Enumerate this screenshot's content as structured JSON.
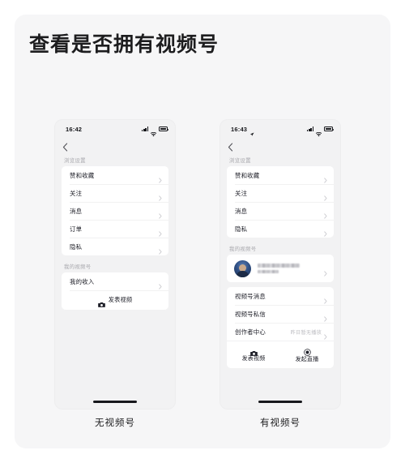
{
  "page": {
    "title": "查看是否拥有视频号",
    "background_color": "#ffffff",
    "card_color": "#f6f6f7"
  },
  "phones": [
    {
      "id": "no-channel",
      "caption": "无视频号",
      "status_bar": {
        "time": "16:42",
        "location_arrow": false,
        "signal_icon": "signal-bars-icon",
        "wifi_icon": "wifi-icon",
        "battery_icon": "battery-icon"
      },
      "nav": {
        "back_icon": "chevron-left-icon"
      },
      "sections": [
        {
          "header": "浏览设置",
          "rows": [
            {
              "label": "赞和收藏",
              "extra": "",
              "chevron": true
            },
            {
              "label": "关注",
              "extra": "",
              "chevron": true
            },
            {
              "label": "消息",
              "extra": "",
              "chevron": true
            },
            {
              "label": "订单",
              "extra": "",
              "chevron": true
            },
            {
              "label": "隐私",
              "extra": "",
              "chevron": true
            }
          ]
        },
        {
          "header": "我的视频号",
          "rows": [
            {
              "label": "我的收入",
              "extra": "",
              "chevron": true
            }
          ],
          "actions": [
            {
              "label": "发表视频",
              "icon": "camera-icon"
            }
          ]
        }
      ]
    },
    {
      "id": "has-channel",
      "caption": "有视频号",
      "status_bar": {
        "time": "16:43",
        "location_arrow": true,
        "signal_icon": "signal-bars-icon",
        "wifi_icon": "wifi-icon",
        "battery_icon": "battery-icon"
      },
      "nav": {
        "back_icon": "chevron-left-icon"
      },
      "sections": [
        {
          "header": "浏览设置",
          "rows": [
            {
              "label": "赞和收藏",
              "extra": "",
              "chevron": true
            },
            {
              "label": "关注",
              "extra": "",
              "chevron": true
            },
            {
              "label": "消息",
              "extra": "",
              "chevron": true
            },
            {
              "label": "隐私",
              "extra": "",
              "chevron": true
            }
          ]
        },
        {
          "header": "我的视频号",
          "profile": {
            "name_redacted": true,
            "subtitle_redacted": true,
            "avatar": "user-avatar"
          },
          "rows": [
            {
              "label": "视频号消息",
              "extra": "",
              "chevron": true
            },
            {
              "label": "视频号私信",
              "extra": "",
              "chevron": true
            },
            {
              "label": "创作者中心",
              "extra": "昨日暂无播放",
              "chevron": true
            }
          ],
          "actions": [
            {
              "label": "发表视频",
              "icon": "camera-icon"
            },
            {
              "label": "发起直播",
              "icon": "live-broadcast-icon"
            }
          ]
        }
      ]
    }
  ]
}
